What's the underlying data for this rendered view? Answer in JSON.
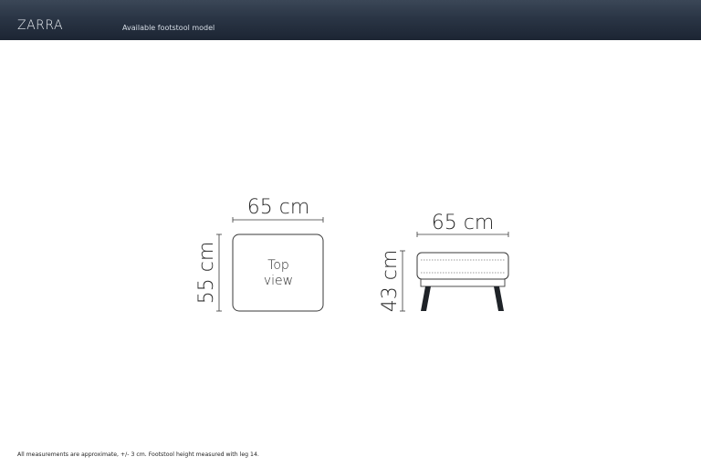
{
  "header": {
    "brand": "ZARRA",
    "subtitle": "Available footstool model"
  },
  "top_view": {
    "width_label": "65 cm",
    "depth_label": "55 cm",
    "caption_line1": "Top",
    "caption_line2": "view"
  },
  "side_view": {
    "width_label": "65 cm",
    "height_label": "43 cm"
  },
  "footer": {
    "note": "All measurements are approximate, +/- 3 cm. Footstool height measured with leg 14."
  },
  "colors": {
    "header_bg": "#2a3545",
    "line": "#3a3a3a",
    "leg": "#1f2328"
  }
}
